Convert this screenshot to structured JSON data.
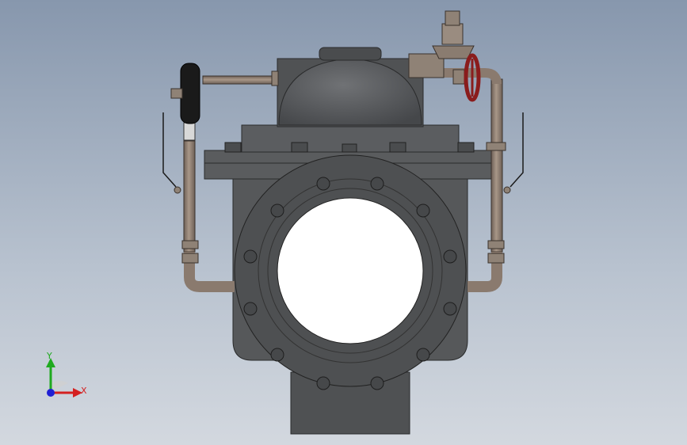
{
  "viewport": {
    "background_top": "#8797ad",
    "background_bottom": "#d3d8df"
  },
  "model": {
    "body_color": "#56585a",
    "flange_color": "#4e5052",
    "pipe_color": "#8a7a6e",
    "handwheel_color": "#8a1c1c"
  },
  "triad": {
    "x_label": "X",
    "y_label": "Y",
    "x_color": "#d42020",
    "y_color": "#1faa1f",
    "z_color": "#2020d4"
  }
}
